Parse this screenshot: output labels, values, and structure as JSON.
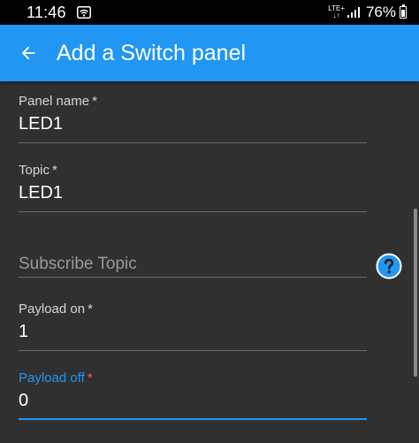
{
  "status_bar": {
    "time": "11:46",
    "network": "LTE+",
    "battery": "76%"
  },
  "app_bar": {
    "title": "Add a Switch panel",
    "back_icon": "arrow-back-icon",
    "background": "#2196f3"
  },
  "form": {
    "panel_name": {
      "label": "Panel name",
      "required_mark": "*",
      "value": "LED1"
    },
    "topic": {
      "label": "Topic",
      "required_mark": "*",
      "value": "LED1"
    },
    "subscribe_topic": {
      "placeholder": "Subscribe Topic",
      "help_icon": "help-icon"
    },
    "payload_on": {
      "label": "Payload on",
      "required_mark": "*",
      "value": "1"
    },
    "payload_off": {
      "label": "Payload off",
      "required_mark": "*",
      "value": "0",
      "focused": true
    }
  },
  "colors": {
    "accent": "#2196f3",
    "background": "#303030",
    "required_focused": "#ff5252"
  }
}
